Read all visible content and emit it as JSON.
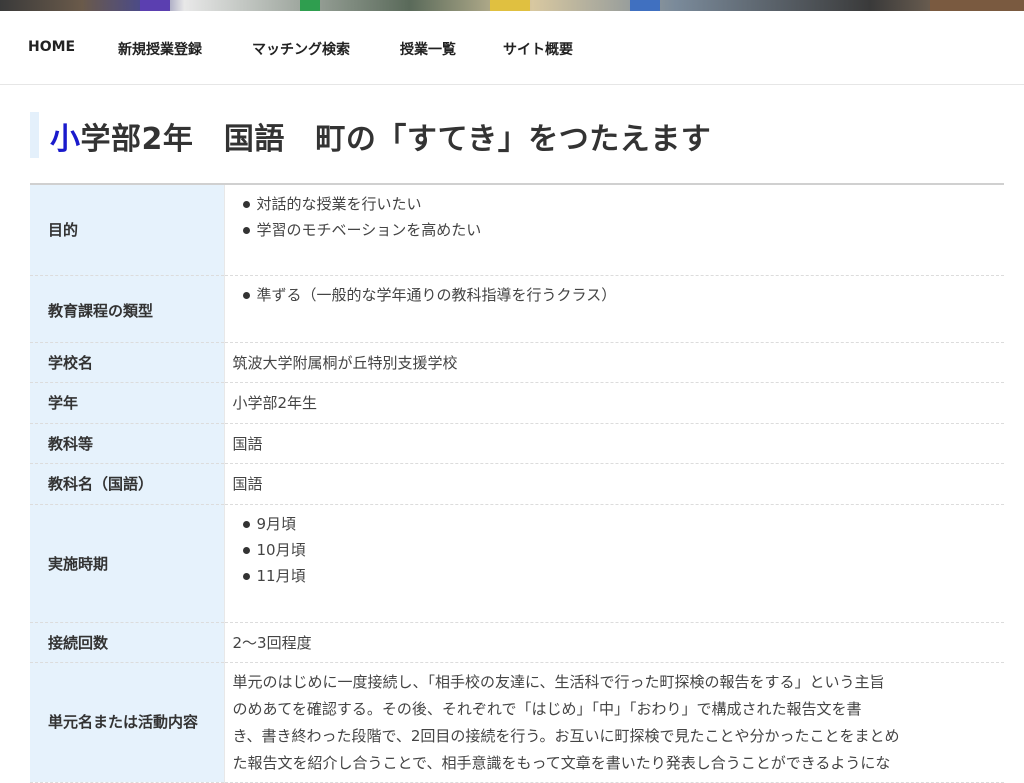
{
  "nav": {
    "items": [
      "HOME",
      "新規授業登録",
      "マッチング検索",
      "授業一覧",
      "サイト概要"
    ]
  },
  "page": {
    "title_first_char": "小",
    "title_rest": "学部2年　国語　町の「すてき」をつたえます"
  },
  "colors": {
    "title_accent": "#1a1acc",
    "label_bg": "#e6f2fc",
    "title_bar": "#e4f0fb"
  },
  "table": {
    "purpose": {
      "label": "目的",
      "items": [
        "対話的な授業を行いたい",
        "学習のモチベーションを高めたい"
      ]
    },
    "curriculum": {
      "label": "教育課程の類型",
      "items": [
        "準ずる（一般的な学年通りの教科指導を行うクラス）"
      ]
    },
    "school": {
      "label": "学校名",
      "value": "筑波大学附属桐が丘特別支援学校"
    },
    "grade": {
      "label": "学年",
      "value": "小学部2年生"
    },
    "subject": {
      "label": "教科等",
      "value": "国語"
    },
    "subject_name": {
      "label": "教科名（国語）",
      "value": "国語"
    },
    "period": {
      "label": "実施時期",
      "items": [
        "9月頃",
        "10月頃",
        "11月頃"
      ]
    },
    "connections": {
      "label": "接続回数",
      "value": "2〜3回程度"
    },
    "unit": {
      "label": "単元名または活動内容",
      "lines": [
        "単元のはじめに一度接続し、「相手校の友達に、生活科で行った町探検の報告をする」という主旨",
        "のめあてを確認する。その後、それぞれで「はじめ」「中」「おわり」で構成された報告文を書",
        "き、書き終わった段階で、2回目の接続を行う。お互いに町探検で見たことや分かったことをまとめ",
        "た報告文を紹介し合うことで、相手意識をもって文章を書いたり発表し合うことができるようにな"
      ]
    }
  }
}
